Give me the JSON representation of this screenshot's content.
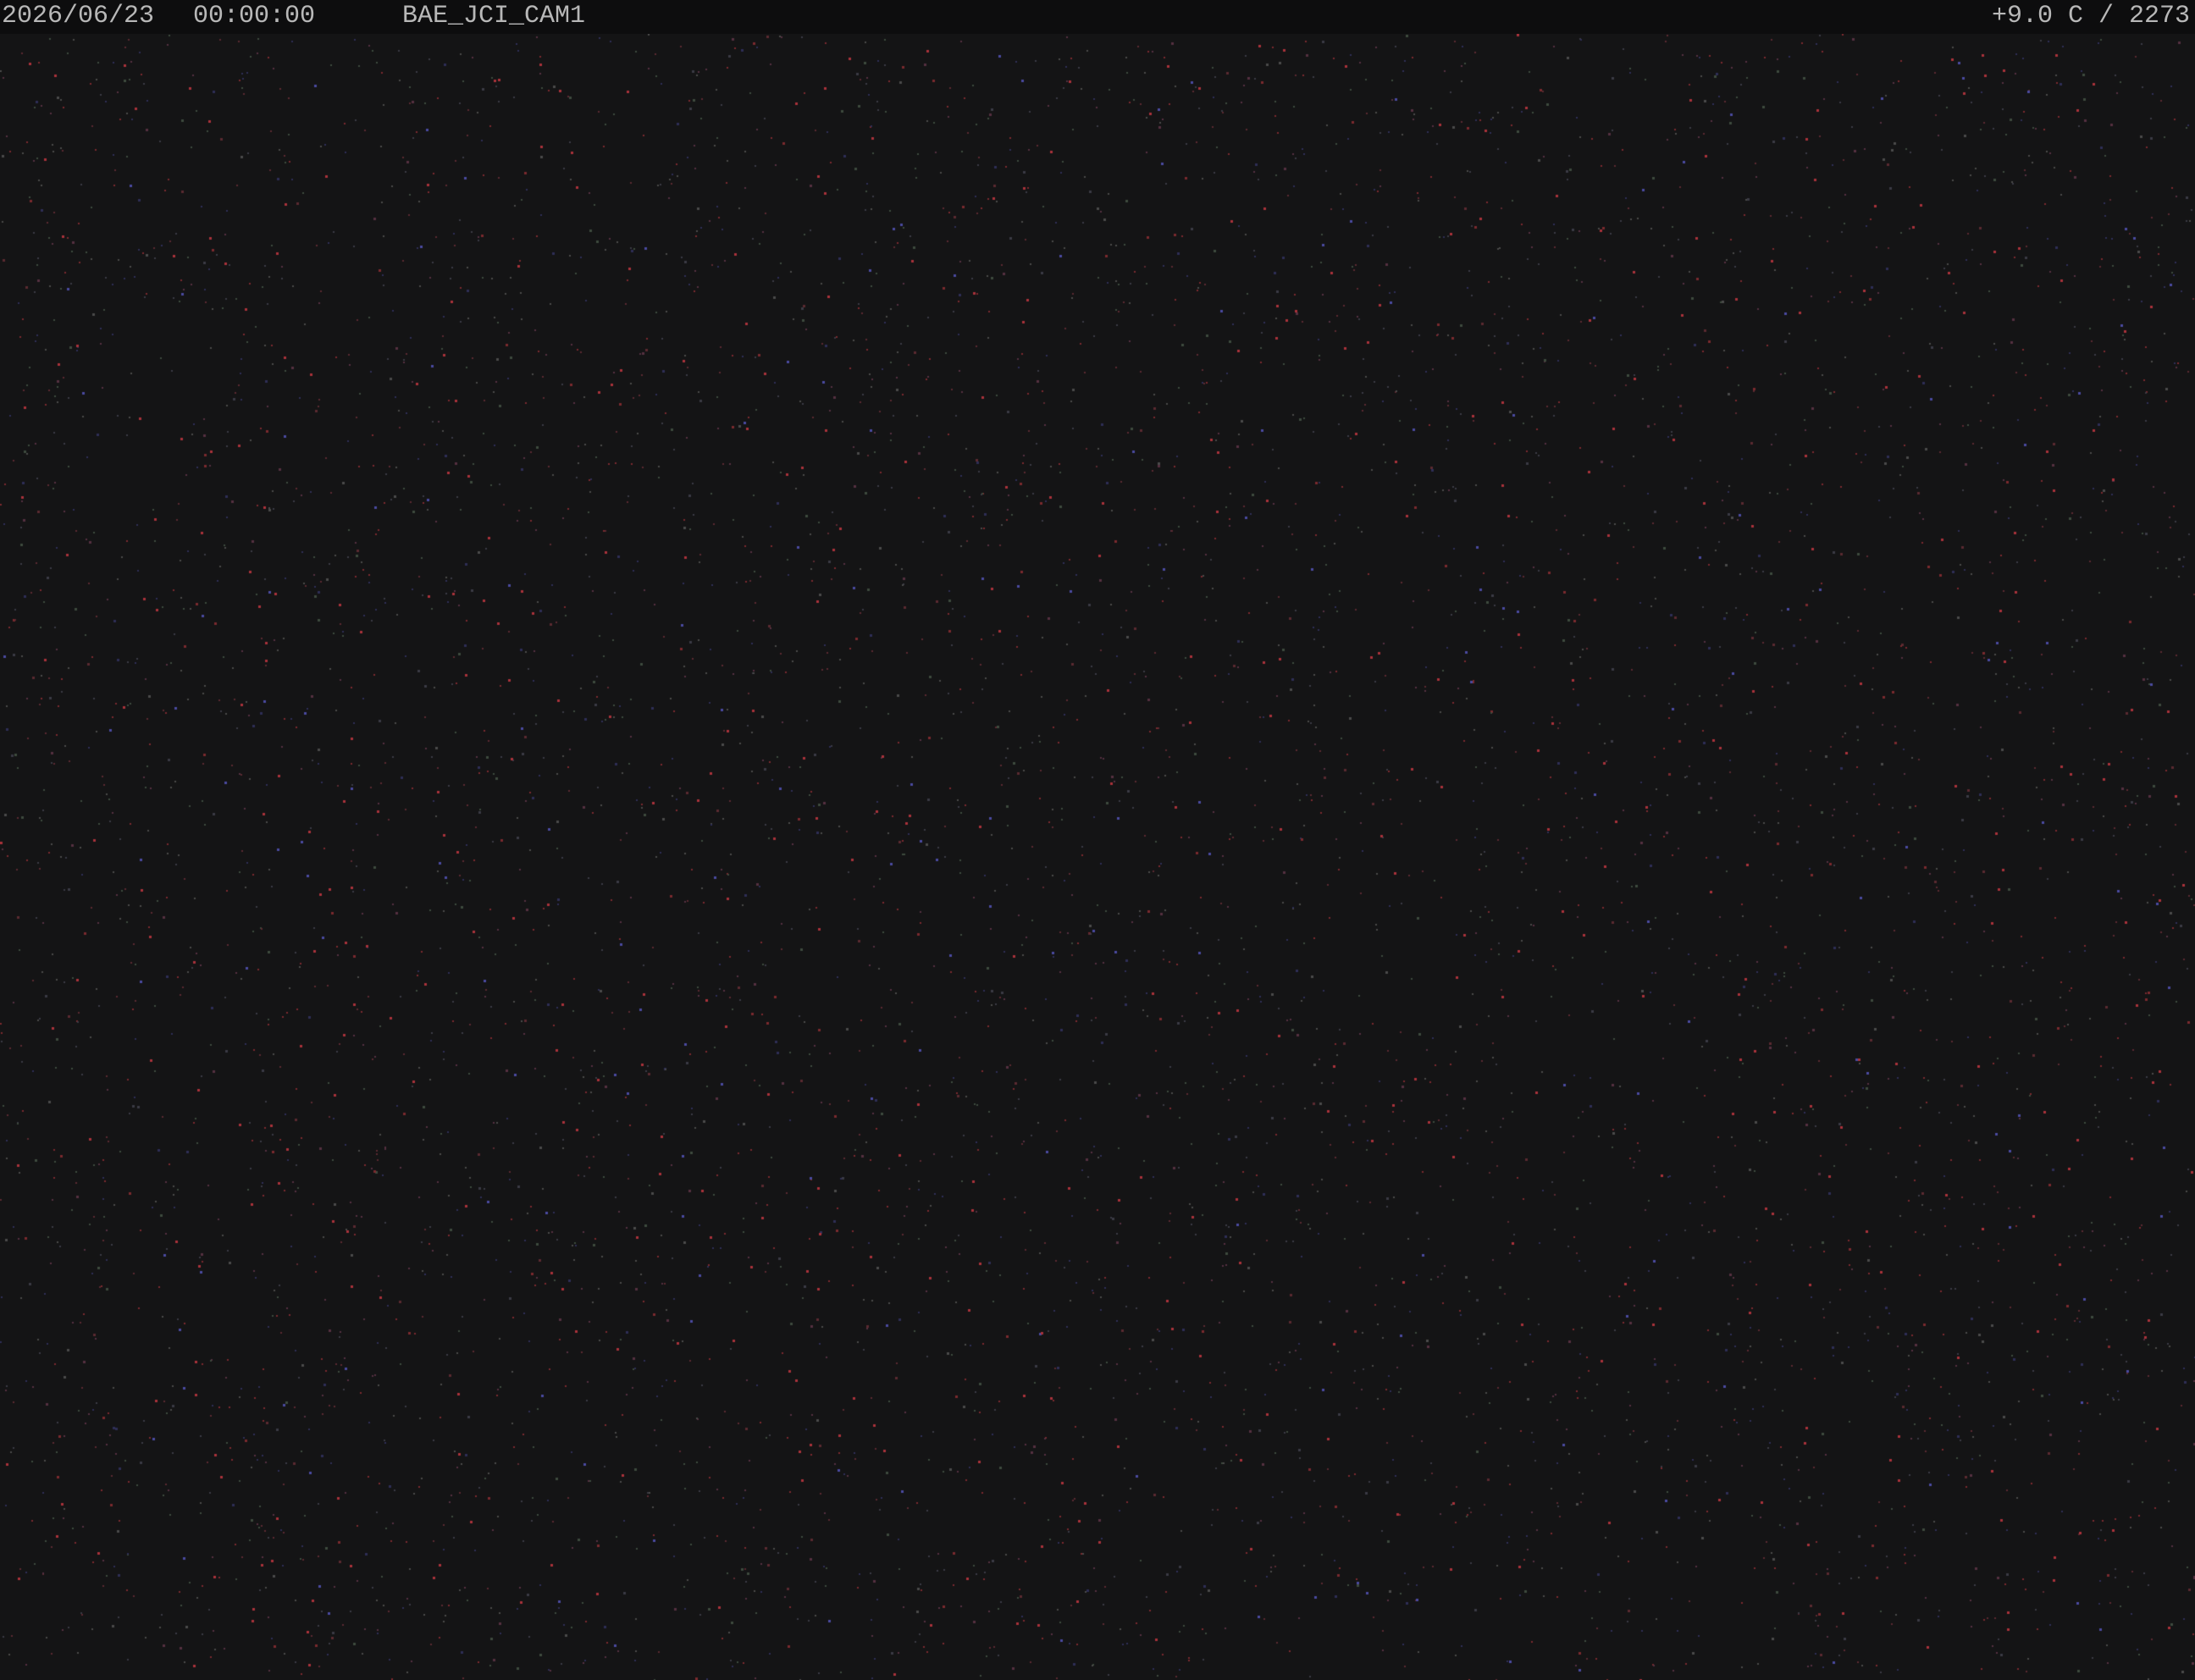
{
  "overlay": {
    "date": "2026/06/23",
    "time": "00:00:00",
    "camera_id": "BAE_JCI_CAM1",
    "temperature_reading": "+9.0 C / 2273"
  },
  "scene": {
    "description_icon": "night-sky-noise",
    "background_color": "#141415",
    "overlay_bar_color": "#0d0d0e",
    "text_color": "#b8b8b8"
  }
}
